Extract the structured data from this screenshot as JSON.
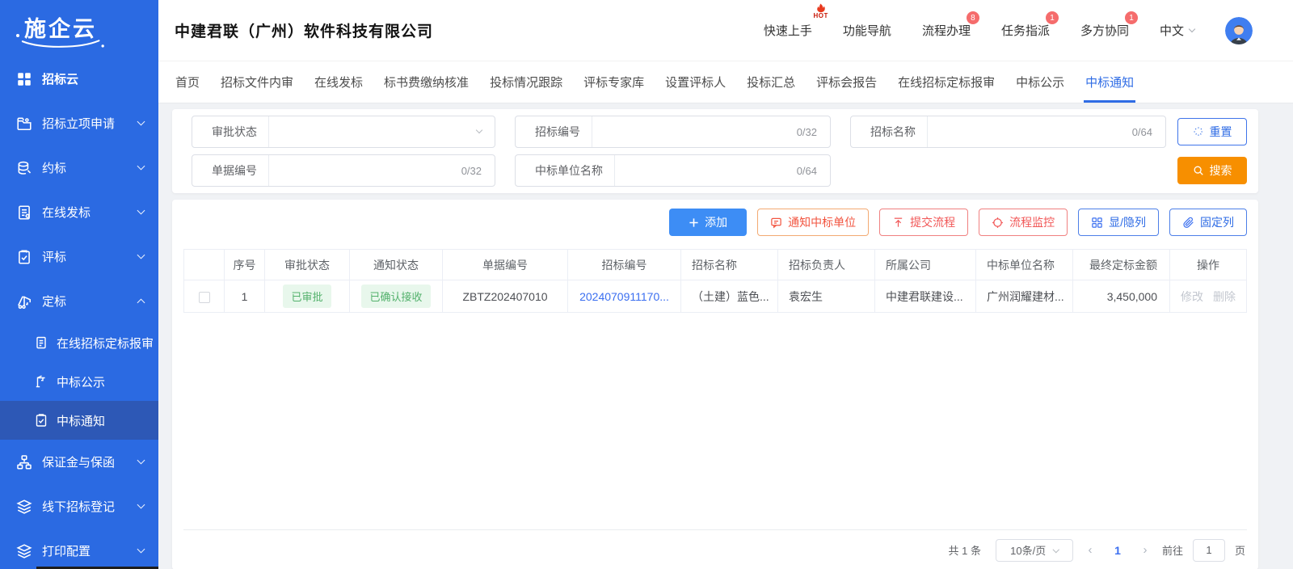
{
  "brand": {
    "logo_text": "施企云"
  },
  "colors": {
    "sidebar_blue": "#2b6ae2",
    "primary_blue": "#2f6ce5",
    "add_blue": "#3d8df5",
    "search_orange": "#f78f00",
    "danger_red": "#f15656",
    "notify_red": "#f25540",
    "success_green": "#53b16c",
    "badge_red": "#f56c6c",
    "active_menu_blue": "#2d58b6"
  },
  "header": {
    "company_title": "中建君联（广州）软件科技有限公司",
    "nav": [
      {
        "label": "快速上手",
        "badge": "HOT",
        "icon": "flame-icon"
      },
      {
        "label": "功能导航"
      },
      {
        "label": "流程办理",
        "badge": "8"
      },
      {
        "label": "任务指派",
        "badge": "1"
      },
      {
        "label": "多方协同",
        "badge": "1"
      }
    ],
    "language": "中文",
    "language_icon": "chevron-down-icon",
    "avatar_icon": "user-avatar"
  },
  "sidebar": {
    "items": [
      {
        "label": "招标云",
        "icon": "grid-icon"
      },
      {
        "label": "招标立项申请",
        "icon": "folder-icon",
        "chevron": "down"
      },
      {
        "label": "约标",
        "icon": "coins-icon",
        "chevron": "down"
      },
      {
        "label": "在线发标",
        "icon": "document-icon",
        "chevron": "down"
      },
      {
        "label": "评标",
        "icon": "clipboard-check-icon",
        "chevron": "down"
      },
      {
        "label": "定标",
        "icon": "crane-icon",
        "chevron": "up",
        "expanded": true,
        "children": [
          {
            "label": "在线招标定标报审",
            "icon": "file-lines-icon"
          },
          {
            "label": "中标公示",
            "icon": "hoist-icon"
          },
          {
            "label": "中标通知",
            "icon": "notice-clipboard-icon",
            "active": true
          }
        ]
      },
      {
        "label": "保证金与保函",
        "icon": "org-chart-icon",
        "chevron": "down"
      },
      {
        "label": "线下招标登记",
        "icon": "layers-icon",
        "chevron": "down"
      },
      {
        "label": "打印配置",
        "icon": "layers-icon",
        "chevron": "down"
      }
    ]
  },
  "tabs": {
    "items": [
      "首页",
      "招标文件内审",
      "在线发标",
      "标书费缴纳核准",
      "投标情况跟踪",
      "评标专家库",
      "设置评标人",
      "投标汇总",
      "评标会报告",
      "在线招标定标报审",
      "中标公示",
      "中标通知"
    ],
    "active": "中标通知"
  },
  "filters": {
    "fields": [
      {
        "label": "审批状态",
        "type": "select",
        "value": "",
        "icon": "chevron-down-icon"
      },
      {
        "label": "招标编号",
        "counter": "0/32"
      },
      {
        "label": "招标名称",
        "counter": "0/64"
      },
      {
        "label": "单据编号",
        "counter": "0/32"
      },
      {
        "label": "中标单位名称",
        "counter": "0/64"
      }
    ],
    "reset": {
      "label": "重置",
      "icon": "sparkle-icon"
    },
    "search": {
      "label": "搜索",
      "icon": "search-icon"
    }
  },
  "toolbar": {
    "buttons": [
      {
        "label": "添加",
        "icon": "plus-icon"
      },
      {
        "label": "通知中标单位",
        "icon": "message-icon"
      },
      {
        "label": "提交流程",
        "icon": "upload-icon"
      },
      {
        "label": "流程监控",
        "icon": "target-icon"
      },
      {
        "label": "显/隐列",
        "icon": "grid-columns-icon"
      },
      {
        "label": "固定列",
        "icon": "paperclip-icon"
      }
    ]
  },
  "table": {
    "columns": [
      "序号",
      "审批状态",
      "通知状态",
      "单据编号",
      "招标编号",
      "招标名称",
      "招标负责人",
      "所属公司",
      "中标单位名称",
      "最终定标金额",
      "操作"
    ],
    "rows": [
      {
        "seq": "1",
        "approval_status": "已审批",
        "notify_status": "已确认接收",
        "doc_no": "ZBTZ202407010",
        "tender_no": "2024070911170...",
        "tender_name": "（土建）蓝色...",
        "owner": "袁宏生",
        "company": "中建君联建设...",
        "winner": "广州润耀建材...",
        "amount": "3,450,000",
        "action_edit": "修改",
        "action_delete": "删除"
      }
    ]
  },
  "pagination": {
    "total": "共 1 条",
    "page_size": "10条/页",
    "prev_icon": "chevron-left-icon",
    "current": "1",
    "next_icon": "chevron-right-icon",
    "goto_label": "前往",
    "goto_value": "1",
    "unit_label": "页"
  }
}
